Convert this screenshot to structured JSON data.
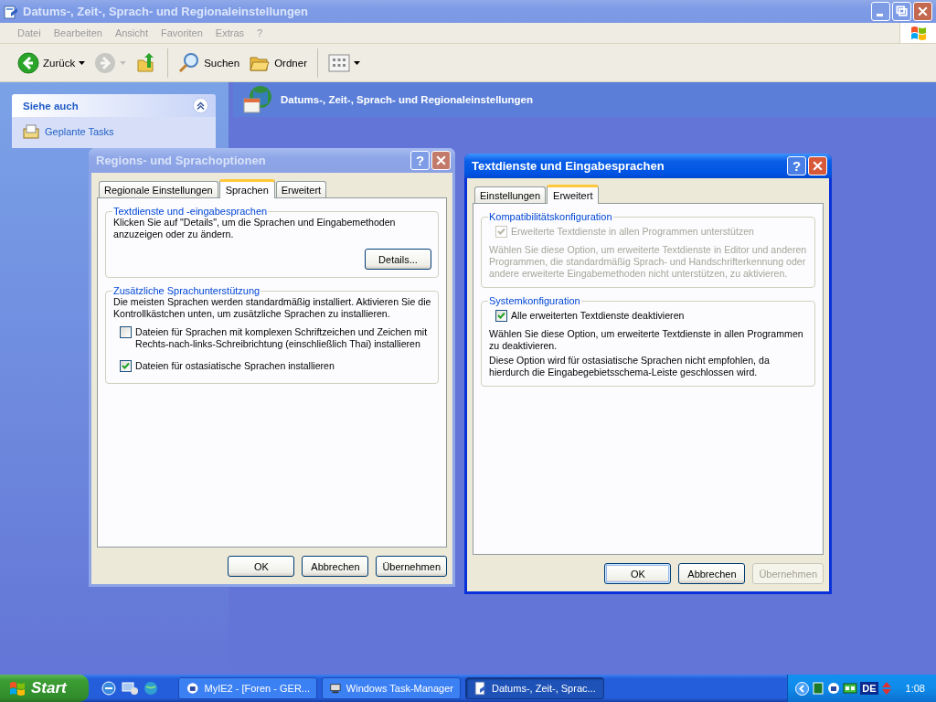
{
  "window": {
    "title": "Datums-, Zeit-, Sprach- und Regionaleinstellungen",
    "active": false,
    "menu": [
      "Datei",
      "Bearbeiten",
      "Ansicht",
      "Favoriten",
      "Extras",
      "?"
    ],
    "toolbar": [
      {
        "kind": "back",
        "label": "Zurück",
        "disabled": false
      },
      {
        "kind": "forward",
        "disabled": true
      },
      {
        "kind": "up",
        "disabled": false
      },
      {
        "kind": "search",
        "label": "Suchen",
        "disabled": false
      },
      {
        "kind": "folders",
        "label": "Ordner",
        "disabled": false
      },
      {
        "kind": "views",
        "disabled": false
      }
    ]
  },
  "sidebar": {
    "title": "Siehe auch",
    "expanded": true,
    "items": [
      "Geplante Tasks"
    ]
  },
  "header": {
    "title": "Datums-, Zeit-, Sprach- und Regionaleinstellungen"
  },
  "dialogs": [
    {
      "title": "Regions- und Sprachoptionen",
      "active": false,
      "help": "?",
      "tabs": [
        {
          "label": "Regionale Einstellungen",
          "selected": false
        },
        {
          "label": "Sprachen",
          "selected": true
        },
        {
          "label": "Erweitert",
          "selected": false
        }
      ],
      "groups": [
        {
          "title": "Textdienste und -eingabesprachen",
          "items": [
            {
              "kind": "text",
              "text": "Klicken Sie auf \"Details\", um die Sprachen und Eingabemethoden anzuzeigen oder zu ändern.",
              "disabled": false
            },
            {
              "kind": "button",
              "label": "Details..."
            }
          ]
        },
        {
          "title": "Zusätzliche Sprachunterstützung",
          "items": [
            {
              "kind": "text",
              "text": "Die meisten Sprachen werden standardmäßig installiert. Aktivieren Sie die Kontrollkästchen unten, um zusätzliche Sprachen zu installieren.",
              "disabled": false
            },
            {
              "kind": "checkbox",
              "label": "Dateien für Sprachen mit komplexen Schriftzeichen und Zeichen mit Rechts-nach-links-Schreibrichtung (einschließlich Thai) installieren",
              "checked": false,
              "disabled": false
            },
            {
              "kind": "checkbox",
              "label": "Dateien für ostasiatische Sprachen installieren",
              "checked": true,
              "disabled": false
            }
          ]
        }
      ],
      "buttons": [
        {
          "label": "OK",
          "disabled": false,
          "default": false
        },
        {
          "label": "Abbrechen",
          "disabled": false,
          "default": false
        },
        {
          "label": "Übernehmen",
          "disabled": false,
          "default": false
        }
      ]
    },
    {
      "title": "Textdienste und Eingabesprachen",
      "active": true,
      "help": "?",
      "tabs": [
        {
          "label": "Einstellungen",
          "selected": false
        },
        {
          "label": "Erweitert",
          "selected": true
        }
      ],
      "groups": [
        {
          "title": "Kompatibilitätskonfiguration",
          "items": [
            {
              "kind": "checkbox",
              "label": "Erweiterte Textdienste in allen Programmen unterstützen",
              "checked": true,
              "disabled": true
            },
            {
              "kind": "text",
              "text": "Wählen Sie diese Option, um erweiterte Textdienste in Editor und anderen Programmen, die standardmäßig Sprach- und Handschrifterkennung oder andere erweiterte Eingabemethoden nicht unterstützen, zu aktivieren.",
              "disabled": true
            }
          ]
        },
        {
          "title": "Systemkonfiguration",
          "items": [
            {
              "kind": "checkbox",
              "label": "Alle erweiterten Textdienste deaktivieren",
              "checked": true,
              "disabled": false
            },
            {
              "kind": "text",
              "text": "Wählen Sie diese Option, um erweiterte Textdienste in allen Programmen zu deaktivieren.",
              "disabled": false
            },
            {
              "kind": "text",
              "text": "Diese Option wird für ostasiatische Sprachen nicht empfohlen, da hierdurch die Eingabegebietsschema-Leiste geschlossen wird.",
              "disabled": false
            }
          ]
        }
      ],
      "buttons": [
        {
          "label": "OK",
          "disabled": false,
          "default": true
        },
        {
          "label": "Abbrechen",
          "disabled": false,
          "default": false
        },
        {
          "label": "Übernehmen",
          "disabled": true,
          "default": false
        }
      ]
    }
  ],
  "taskbar": {
    "start": "Start",
    "tasks": [
      {
        "label": "MyIE2 - [Foren - GER...",
        "selected": false
      },
      {
        "label": "Windows Task-Manager",
        "selected": false
      },
      {
        "label": "Datums-, Zeit-, Sprac...",
        "selected": true
      }
    ],
    "language": "DE",
    "clock": "1:08"
  }
}
